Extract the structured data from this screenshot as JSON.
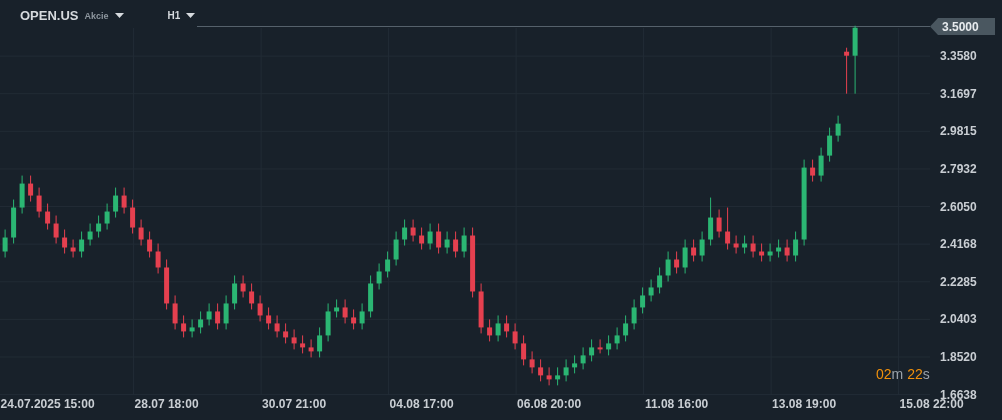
{
  "header": {
    "symbol": "OPEN.US",
    "instrument_type": "Akcie",
    "timeframe": "H1"
  },
  "chart": {
    "current_price": "3.5000",
    "countdown": {
      "minutes": "02",
      "minutes_unit": "m",
      "seconds": "22",
      "seconds_unit": "s"
    },
    "chart_data": {
      "type": "candlestick",
      "grid": true,
      "ylim": [
        1.6638,
        3.358
      ],
      "categories": [
        null,
        null,
        null,
        null,
        null,
        "24.07.2025 15:00",
        null,
        null,
        null,
        null,
        null,
        null,
        null,
        null,
        null,
        null,
        null,
        null,
        null,
        "28.07 18:00",
        null,
        null,
        null,
        null,
        null,
        null,
        null,
        null,
        null,
        null,
        null,
        null,
        null,
        null,
        "30.07 21:00",
        null,
        null,
        null,
        null,
        null,
        null,
        null,
        null,
        null,
        null,
        null,
        null,
        null,
        null,
        "04.08 17:00",
        null,
        null,
        null,
        null,
        null,
        null,
        null,
        null,
        null,
        null,
        null,
        null,
        null,
        null,
        "06.08 20:00",
        null,
        null,
        null,
        null,
        null,
        null,
        null,
        null,
        null,
        null,
        null,
        null,
        null,
        null,
        "11.08 16:00",
        null,
        null,
        null,
        null,
        null,
        null,
        null,
        null,
        null,
        null,
        null,
        null,
        null,
        null,
        "13.08 19:00",
        null,
        null,
        null,
        null,
        null,
        null,
        null,
        null,
        null,
        null,
        null,
        null,
        null,
        null,
        "15.08 22:00"
      ],
      "ohlc": [
        [
          2.38,
          2.49,
          2.35,
          2.45
        ],
        [
          2.45,
          2.64,
          2.42,
          2.6
        ],
        [
          2.6,
          2.76,
          2.57,
          2.72
        ],
        [
          2.72,
          2.76,
          2.63,
          2.66
        ],
        [
          2.66,
          2.7,
          2.55,
          2.58
        ],
        [
          2.58,
          2.62,
          2.49,
          2.52
        ],
        [
          2.52,
          2.56,
          2.42,
          2.45
        ],
        [
          2.45,
          2.49,
          2.37,
          2.4
        ],
        [
          2.4,
          2.44,
          2.35,
          2.38
        ],
        [
          2.38,
          2.48,
          2.35,
          2.44
        ],
        [
          2.44,
          2.52,
          2.41,
          2.48
        ],
        [
          2.48,
          2.56,
          2.45,
          2.52
        ],
        [
          2.52,
          2.62,
          2.49,
          2.58
        ],
        [
          2.58,
          2.7,
          2.55,
          2.66
        ],
        [
          2.66,
          2.7,
          2.57,
          2.6
        ],
        [
          2.6,
          2.64,
          2.47,
          2.5
        ],
        [
          2.5,
          2.54,
          2.41,
          2.44
        ],
        [
          2.44,
          2.48,
          2.35,
          2.38
        ],
        [
          2.38,
          2.42,
          2.27,
          2.3
        ],
        [
          2.3,
          2.34,
          2.09,
          2.12
        ],
        [
          2.12,
          2.16,
          1.99,
          2.02
        ],
        [
          2.02,
          2.06,
          1.95,
          1.98
        ],
        [
          1.98,
          2.04,
          1.95,
          2.0
        ],
        [
          2.0,
          2.08,
          1.97,
          2.04
        ],
        [
          2.04,
          2.12,
          2.01,
          2.08
        ],
        [
          2.08,
          2.12,
          1.99,
          2.02
        ],
        [
          2.02,
          2.16,
          1.99,
          2.12
        ],
        [
          2.12,
          2.26,
          2.09,
          2.22
        ],
        [
          2.22,
          2.26,
          2.15,
          2.18
        ],
        [
          2.18,
          2.22,
          2.09,
          2.12
        ],
        [
          2.12,
          2.16,
          2.03,
          2.06
        ],
        [
          2.06,
          2.1,
          1.99,
          2.02
        ],
        [
          2.02,
          2.06,
          1.95,
          1.98
        ],
        [
          1.98,
          2.02,
          1.92,
          1.95
        ],
        [
          1.95,
          1.99,
          1.89,
          1.92
        ],
        [
          1.92,
          1.96,
          1.87,
          1.9
        ],
        [
          1.9,
          1.94,
          1.85,
          1.88
        ],
        [
          1.88,
          2.0,
          1.85,
          1.96
        ],
        [
          1.96,
          2.12,
          1.93,
          2.08
        ],
        [
          2.08,
          2.14,
          2.05,
          2.1
        ],
        [
          2.1,
          2.14,
          2.02,
          2.05
        ],
        [
          2.05,
          2.09,
          1.99,
          2.02
        ],
        [
          2.02,
          2.12,
          1.99,
          2.08
        ],
        [
          2.08,
          2.26,
          2.05,
          2.22
        ],
        [
          2.22,
          2.32,
          2.19,
          2.28
        ],
        [
          2.28,
          2.38,
          2.25,
          2.34
        ],
        [
          2.34,
          2.48,
          2.31,
          2.44
        ],
        [
          2.44,
          2.54,
          2.41,
          2.5
        ],
        [
          2.5,
          2.54,
          2.43,
          2.46
        ],
        [
          2.46,
          2.5,
          2.39,
          2.42
        ],
        [
          2.42,
          2.52,
          2.39,
          2.48
        ],
        [
          2.48,
          2.52,
          2.37,
          2.4
        ],
        [
          2.4,
          2.48,
          2.37,
          2.44
        ],
        [
          2.44,
          2.48,
          2.35,
          2.38
        ],
        [
          2.38,
          2.5,
          2.35,
          2.46
        ],
        [
          2.46,
          2.5,
          2.15,
          2.18
        ],
        [
          2.18,
          2.22,
          1.97,
          2.0
        ],
        [
          2.0,
          2.04,
          1.93,
          1.96
        ],
        [
          1.96,
          2.06,
          1.93,
          2.02
        ],
        [
          2.02,
          2.06,
          1.95,
          1.98
        ],
        [
          1.98,
          2.02,
          1.89,
          1.92
        ],
        [
          1.92,
          1.96,
          1.81,
          1.84
        ],
        [
          1.84,
          1.88,
          1.77,
          1.8
        ],
        [
          1.8,
          1.84,
          1.73,
          1.76
        ],
        [
          1.76,
          1.8,
          1.71,
          1.74
        ],
        [
          1.74,
          1.8,
          1.71,
          1.76
        ],
        [
          1.76,
          1.84,
          1.73,
          1.8
        ],
        [
          1.8,
          1.86,
          1.77,
          1.82
        ],
        [
          1.82,
          1.9,
          1.79,
          1.86
        ],
        [
          1.86,
          1.94,
          1.83,
          1.9
        ],
        [
          1.9,
          1.94,
          1.87,
          1.89
        ],
        [
          1.89,
          1.96,
          1.86,
          1.92
        ],
        [
          1.92,
          2.0,
          1.89,
          1.96
        ],
        [
          1.96,
          2.06,
          1.93,
          2.02
        ],
        [
          2.02,
          2.14,
          1.99,
          2.1
        ],
        [
          2.1,
          2.2,
          2.07,
          2.16
        ],
        [
          2.16,
          2.24,
          2.13,
          2.2
        ],
        [
          2.2,
          2.3,
          2.17,
          2.26
        ],
        [
          2.26,
          2.38,
          2.23,
          2.34
        ],
        [
          2.34,
          2.38,
          2.27,
          2.3
        ],
        [
          2.3,
          2.44,
          2.27,
          2.4
        ],
        [
          2.4,
          2.44,
          2.33,
          2.36
        ],
        [
          2.36,
          2.48,
          2.33,
          2.44
        ],
        [
          2.44,
          2.65,
          2.41,
          2.55
        ],
        [
          2.55,
          2.59,
          2.45,
          2.48
        ],
        [
          2.48,
          2.6,
          2.39,
          2.42
        ],
        [
          2.42,
          2.46,
          2.37,
          2.4
        ],
        [
          2.4,
          2.46,
          2.37,
          2.42
        ],
        [
          2.42,
          2.46,
          2.35,
          2.38
        ],
        [
          2.38,
          2.42,
          2.33,
          2.36
        ],
        [
          2.36,
          2.42,
          2.33,
          2.38
        ],
        [
          2.38,
          2.44,
          2.35,
          2.4
        ],
        [
          2.4,
          2.44,
          2.33,
          2.36
        ],
        [
          2.36,
          2.48,
          2.33,
          2.44
        ],
        [
          2.44,
          2.84,
          2.41,
          2.8
        ],
        [
          2.8,
          2.84,
          2.73,
          2.76
        ],
        [
          2.76,
          2.9,
          2.73,
          2.86
        ],
        [
          2.86,
          3.0,
          2.83,
          2.96
        ],
        [
          2.96,
          3.06,
          2.93,
          3.02
        ],
        [
          3.38,
          3.4,
          3.17,
          3.36
        ],
        [
          3.36,
          3.51,
          3.17,
          3.5
        ],
        null,
        null,
        null,
        null,
        null,
        null,
        null,
        null,
        null
      ],
      "yticks": [
        {
          "value": 3.358,
          "label": "3.3580"
        },
        {
          "value": 3.1697,
          "label": "3.1697"
        },
        {
          "value": 2.9815,
          "label": "2.9815"
        },
        {
          "value": 2.7932,
          "label": "2.7932"
        },
        {
          "value": 2.605,
          "label": "2.6050"
        },
        {
          "value": 2.4168,
          "label": "2.4168"
        },
        {
          "value": 2.2285,
          "label": "2.2285"
        },
        {
          "value": 2.0403,
          "label": "2.0403"
        },
        {
          "value": 1.852,
          "label": "1.8520"
        },
        {
          "value": 1.6638,
          "label": "1.6638"
        }
      ]
    }
  }
}
